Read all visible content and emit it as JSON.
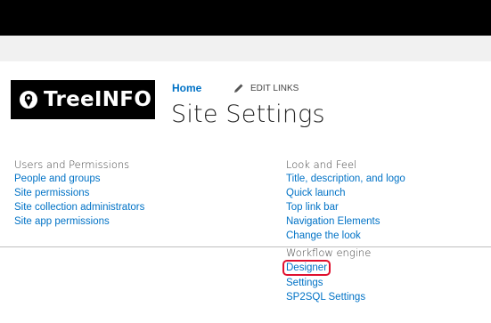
{
  "logo": {
    "text": "TreeINFO",
    "icon": "location-pin-icon"
  },
  "breadcrumb": {
    "home": "Home",
    "edit_links": "EDIT LINKS"
  },
  "page": {
    "title": "Site Settings"
  },
  "users_permissions": {
    "heading": "Users and Permissions",
    "links": [
      "People and groups",
      "Site permissions",
      "Site collection administrators",
      "Site app permissions"
    ]
  },
  "look_and_feel": {
    "heading": "Look and Feel",
    "links": [
      "Title, description, and logo",
      "Quick launch",
      "Top link bar",
      "Navigation Elements",
      "Change the look"
    ]
  },
  "workflow_engine": {
    "heading": "Workflow engine",
    "links": [
      "Designer",
      "Settings",
      "SP2SQL Settings"
    ],
    "highlighted": "Designer",
    "highlight_color": "#e0102e"
  },
  "colors": {
    "link": "#0072c6",
    "top_bar": "#000000"
  }
}
